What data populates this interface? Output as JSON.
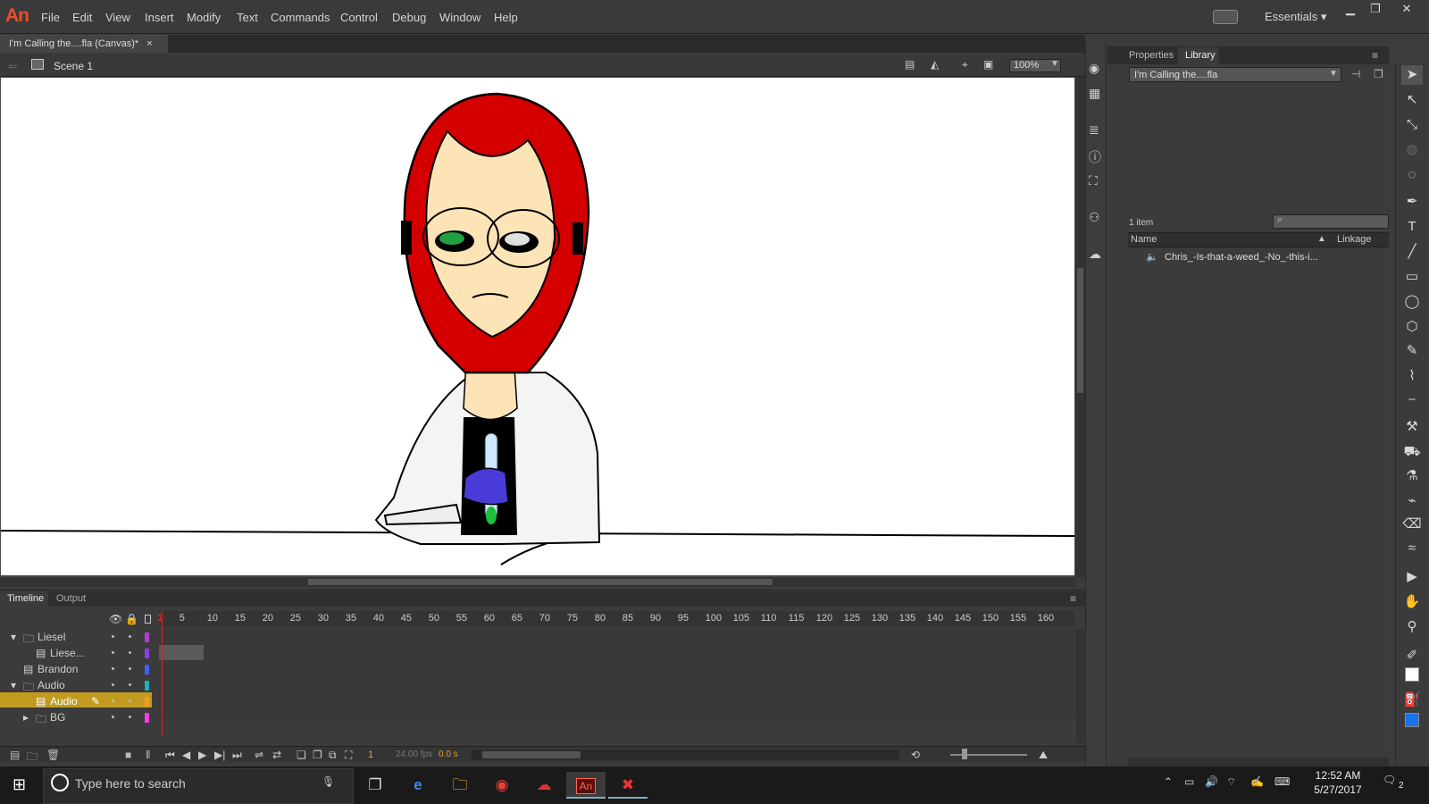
{
  "app": {
    "logo": "An"
  },
  "menu": [
    "File",
    "Edit",
    "View",
    "Insert",
    "Modify",
    "Text",
    "Commands",
    "Control",
    "Debug",
    "Window",
    "Help"
  ],
  "workspace": {
    "label": "Essentials"
  },
  "window_controls": {
    "minimize": "▁",
    "restore": "❐",
    "close": "✕"
  },
  "document": {
    "tab_label": "I'm Calling the....fla (Canvas)*",
    "close": "×",
    "scene": "Scene 1",
    "zoom": "100%"
  },
  "panel": {
    "tabs": [
      "Properties",
      "Library"
    ],
    "active_tab": "Library",
    "library_select": "I'm Calling the....fla",
    "item_count": "1 item",
    "columns": {
      "name": "Name",
      "linkage": "Linkage"
    },
    "items": [
      "Chris_-Is-that-a-weed_-No_-this-i..."
    ]
  },
  "timeline": {
    "tabs": [
      "Timeline",
      "Output"
    ],
    "ruler": [
      "1",
      "5",
      "10",
      "15",
      "20",
      "25",
      "30",
      "35",
      "40",
      "45",
      "50",
      "55",
      "60",
      "65",
      "70",
      "75",
      "80",
      "85",
      "90",
      "95",
      "100",
      "105",
      "110",
      "115",
      "120",
      "125",
      "130",
      "135",
      "140",
      "145",
      "150",
      "155",
      "160"
    ],
    "layers": [
      {
        "name": "Liesel",
        "type": "folder",
        "color": "#b040d0"
      },
      {
        "name": "Liese...",
        "type": "layer",
        "color": "#9040e0"
      },
      {
        "name": "Brandon",
        "type": "layer",
        "color": "#4060f0"
      },
      {
        "name": "Audio",
        "type": "folder",
        "color": "#20b0b0"
      },
      {
        "name": "Audio",
        "type": "layer",
        "color": "#f0a020"
      },
      {
        "name": "BG",
        "type": "folder",
        "color": "#f040e0"
      }
    ],
    "current_frame": "1",
    "fps": "24.00 fps",
    "time": "0.0 s"
  },
  "taskbar": {
    "search_placeholder": "Type here to search",
    "time": "12:52 AM",
    "date": "5/27/2017",
    "notifications": "2"
  }
}
